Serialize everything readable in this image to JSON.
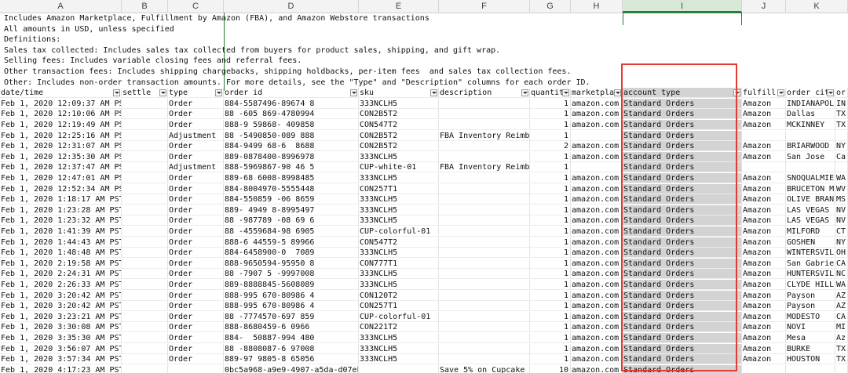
{
  "columns": [
    "A",
    "B",
    "C",
    "D",
    "E",
    "F",
    "G",
    "H",
    "I",
    "J",
    "K"
  ],
  "selected_column": "I",
  "notes": [
    "Includes Amazon Marketplace, Fulfillment by Amazon (FBA), and Amazon Webstore transactions",
    "All amounts in USD, unless specified",
    "Definitions:",
    "Sales tax collected: Includes sales tax collected from buyers for product sales, shipping, and gift wrap.",
    "Selling fees: Includes variable closing fees and referral fees.",
    "Other transaction fees: Includes shipping chargebacks, shipping holdbacks, per-item fees  and sales tax collection fees.",
    "Other: Includes non-order transaction amounts. For more details, see the \"Type\" and \"Description\" columns for each order ID."
  ],
  "headers": [
    "date/time",
    "settle",
    "type",
    "order id",
    "sku",
    "description",
    "quantit",
    "marketpla",
    "account type",
    "fulfill",
    "order cit",
    "or"
  ],
  "rows": [
    [
      "Feb 1, 2020 12:09:37 AM PST",
      "",
      "Order",
      "884-5587496-89674 8",
      "333NCLH5",
      "",
      "1",
      "amazon.com",
      "Standard Orders",
      "Amazon",
      "INDIANAPOLI",
      "IN"
    ],
    [
      "Feb 1, 2020 12:10:06 AM PST",
      "",
      "Order",
      "88 -605 869-4780994",
      "CON2B5T2",
      "",
      "1",
      "amazon.com",
      "Standard Orders",
      "Amazon",
      "Dallas",
      "TX"
    ],
    [
      "Feb 1, 2020 12:19:49 AM PST",
      "",
      "Order",
      "888-9 59868- 409858",
      "CON547T2",
      "",
      "1",
      "amazon.com",
      "Standard Orders",
      "Amazon",
      "MCKINNEY",
      "TX"
    ],
    [
      "Feb 1, 2020 12:25:16 AM PST",
      "",
      "Adjustment",
      "88 -5490850-089 888",
      "CON2B5T2",
      "FBA Inventory Reimb",
      "1",
      "",
      "Standard Orders",
      "",
      "",
      ""
    ],
    [
      "Feb 1, 2020 12:31:07 AM PST",
      "",
      "Order",
      "884-9499 68-6  8688",
      "CON2B5T2",
      "",
      "2",
      "amazon.com",
      "Standard Orders",
      "Amazon",
      "BRIARWOOD",
      "NY"
    ],
    [
      "Feb 1, 2020 12:35:30 AM PST",
      "",
      "Order",
      "889-0878400-8996978",
      "333NCLH5",
      "",
      "1",
      "amazon.com",
      "Standard Orders",
      "Amazon",
      "San Jose",
      "Ca"
    ],
    [
      "Feb 1, 2020 12:37:47 AM PST",
      "",
      "Adjustment",
      "888-5969867-90 46 5",
      "CUP-white-01",
      "FBA Inventory Reimb",
      "1",
      "",
      "Standard Orders",
      "",
      "",
      ""
    ],
    [
      "Feb 1, 2020 12:47:01 AM PST",
      "",
      "Order",
      "889-68 6008-8998485",
      "333NCLH5",
      "",
      "1",
      "amazon.com",
      "Standard Orders",
      "Amazon",
      "SNOQUALMIE",
      "WA"
    ],
    [
      "Feb 1, 2020 12:52:34 AM PST",
      "",
      "Order",
      "884-8004970-5555448",
      "CON257T1",
      "",
      "1",
      "amazon.com",
      "Standard Orders",
      "Amazon",
      "BRUCETON MI",
      "WV"
    ],
    [
      "Feb 1, 2020 1:18:17 AM PST",
      "",
      "Order",
      "884-550859 -06 8659",
      "333NCLH5",
      "",
      "1",
      "amazon.com",
      "Standard Orders",
      "Amazon",
      "OLIVE BRANC",
      "MS"
    ],
    [
      "Feb 1, 2020 1:23:28 AM PST",
      "",
      "Order",
      "889- 4949 8-8995497",
      "333NCLH5",
      "",
      "1",
      "amazon.com",
      "Standard Orders",
      "Amazon",
      "LAS VEGAS",
      "NV"
    ],
    [
      "Feb 1, 2020 1:23:32 AM PST",
      "",
      "Order",
      "88 -987789 -08 69 6",
      "333NCLH5",
      "",
      "1",
      "amazon.com",
      "Standard Orders",
      "Amazon",
      "LAS VEGAS",
      "NV"
    ],
    [
      "Feb 1, 2020 1:41:39 AM PST",
      "",
      "Order",
      "88 -4559684-98 6905",
      "CUP-colorful-01",
      "",
      "1",
      "amazon.com",
      "Standard Orders",
      "Amazon",
      "MILFORD",
      "CT"
    ],
    [
      "Feb 1, 2020 1:44:43 AM PST",
      "",
      "Order",
      "888-6 44559-5 89966",
      "CON547T2",
      "",
      "1",
      "amazon.com",
      "Standard Orders",
      "Amazon",
      "GOSHEN",
      "NY"
    ],
    [
      "Feb 1, 2020 1:48:48 AM PST",
      "",
      "Order",
      "884-6458900-0  7089",
      "333NCLH5",
      "",
      "1",
      "amazon.com",
      "Standard Orders",
      "Amazon",
      "WINTERSVILL",
      "OH"
    ],
    [
      "Feb 1, 2020 2:19:58 AM PST",
      "",
      "Order",
      "888-9650594-95950 8",
      "CON777T1",
      "",
      "1",
      "amazon.com",
      "Standard Orders",
      "Amazon",
      "San Gabriel",
      "CA"
    ],
    [
      "Feb 1, 2020 2:24:31 AM PST",
      "",
      "Order",
      "88 -7907 5 -9997008",
      "333NCLH5",
      "",
      "1",
      "amazon.com",
      "Standard Orders",
      "Amazon",
      "HUNTERSVILL",
      "NC"
    ],
    [
      "Feb 1, 2020 2:26:33 AM PST",
      "",
      "Order",
      "889-8888845-5608089",
      "333NCLH5",
      "",
      "1",
      "amazon.com",
      "Standard Orders",
      "Amazon",
      "CLYDE HILL",
      "WA"
    ],
    [
      "Feb 1, 2020 3:20:42 AM PST",
      "",
      "Order",
      "888-995 670-80986 4",
      "CON120T2",
      "",
      "1",
      "amazon.com",
      "Standard Orders",
      "Amazon",
      "Payson",
      "AZ"
    ],
    [
      "Feb 1, 2020 3:20:42 AM PST",
      "",
      "Order",
      "888-995 670-80986 4",
      "CON257T1",
      "",
      "1",
      "amazon.com",
      "Standard Orders",
      "Amazon",
      "Payson",
      "AZ"
    ],
    [
      "Feb 1, 2020 3:23:21 AM PST",
      "",
      "Order",
      "88 -7774570-697 859",
      "CUP-colorful-01",
      "",
      "1",
      "amazon.com",
      "Standard Orders",
      "Amazon",
      "MODESTO",
      "CA"
    ],
    [
      "Feb 1, 2020 3:30:08 AM PST",
      "",
      "Order",
      "888-8680459-6 0966",
      "CON221T2",
      "",
      "1",
      "amazon.com",
      "Standard Orders",
      "Amazon",
      "NOVI",
      "MI"
    ],
    [
      "Feb 1, 2020 3:35:30 AM PST",
      "",
      "Order",
      "884-  50887-994 480",
      "333NCLH5",
      "",
      "1",
      "amazon.com",
      "Standard Orders",
      "Amazon",
      "Mesa",
      "Az"
    ],
    [
      "Feb 1, 2020 3:56:07 AM PST",
      "",
      "Order",
      "88 -8808087-6 97008",
      "333NCLH5",
      "",
      "1",
      "amazon.com",
      "Standard Orders",
      "Amazon",
      "BURKE",
      "TX"
    ],
    [
      "Feb 1, 2020 3:57:34 AM PST",
      "",
      "Order",
      "889-97 9805-8 65056",
      "333NCLH5",
      "",
      "1",
      "amazon.com",
      "Standard Orders",
      "Amazon",
      "HOUSTON",
      "TX"
    ],
    [
      "Feb 1, 2020 4:17:23 AM PST",
      "",
      "",
      "0bc5a968-a9e9-4907-a5da-d07eb9e78-4b",
      "",
      "Save 5% on Cupcake",
      "10",
      "amazon.com",
      "Standard Orders",
      "",
      "",
      ""
    ]
  ],
  "colors": {
    "selected_column": "#2e7d32",
    "highlight_box": "#e53935",
    "selected_fill": "#d3d3d3"
  }
}
